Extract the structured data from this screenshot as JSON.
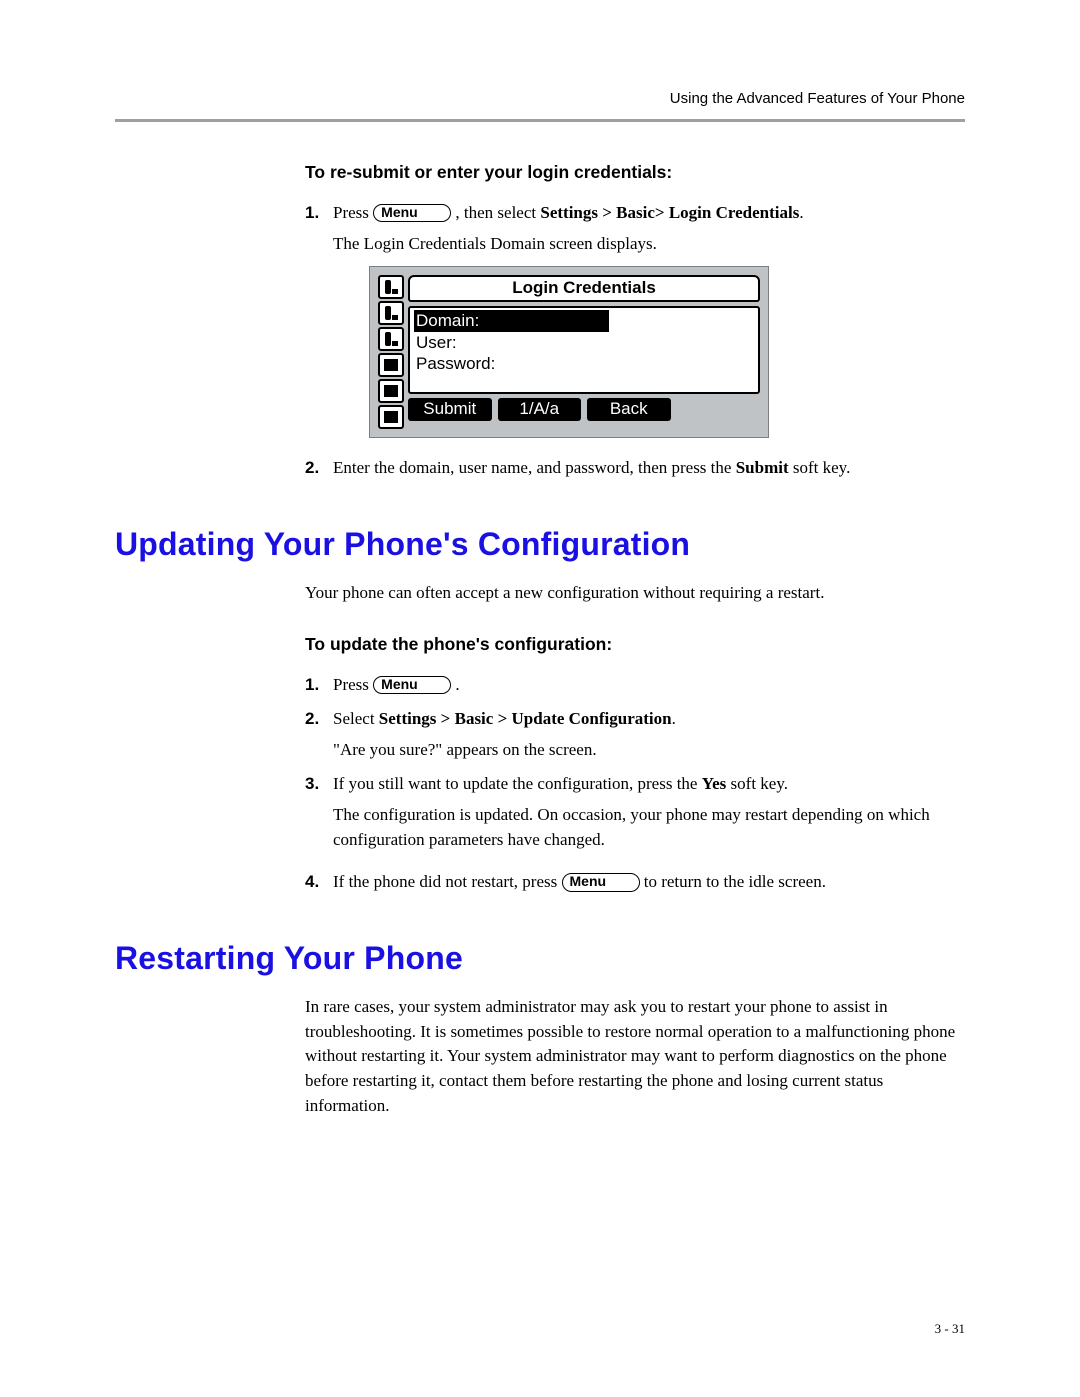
{
  "header": {
    "running_title": "Using the Advanced Features of Your Phone"
  },
  "section_login": {
    "subheading": "To re-submit or enter your login credentials:",
    "step1_num": "1.",
    "step1_a": "Press ",
    "menu_label": "Menu",
    "step1_b": " , then select ",
    "step1_bold": "Settings > Basic> Login Credentials",
    "step1_c": ".",
    "step1_note": "The Login Credentials Domain screen displays.",
    "step2_num": "2.",
    "step2_a": "Enter the domain, user name, and password, then press the ",
    "step2_bold": "Submit",
    "step2_b": " soft key."
  },
  "lcd": {
    "title": "Login Credentials",
    "field1": "Domain:",
    "field2": "User:",
    "field3": "Password:",
    "sk1": "Submit",
    "sk2": "1/A/a",
    "sk3": "Back"
  },
  "section_update": {
    "title": "Updating Your Phone's Configuration",
    "intro": "Your phone can often accept a new configuration without requiring a restart.",
    "subheading": "To update the phone's configuration:",
    "s1_num": "1.",
    "s1_a": "Press ",
    "s1_b": " .",
    "s2_num": "2.",
    "s2_a": "Select ",
    "s2_bold": "Settings > Basic > Update Configuration",
    "s2_b": ".",
    "s2_note": "\"Are you sure?\" appears on the screen.",
    "s3_num": "3.",
    "s3_a": "If you still want to update the configuration, press the ",
    "s3_bold": "Yes",
    "s3_b": " soft key.",
    "s3_note": "The configuration is updated. On occasion, your phone may restart depending on which configuration parameters have changed.",
    "s4_num": "4.",
    "s4_a": "If the phone did not restart, press ",
    "s4_b": " to return to the idle screen."
  },
  "section_restart": {
    "title": "Restarting Your Phone",
    "intro": "In rare cases, your system administrator may ask you to restart your phone to assist in troubleshooting. It is sometimes possible to restore normal operation to a malfunctioning phone without restarting it. Your system administrator may want to perform diagnostics on the phone before restarting it, contact them before restarting the phone and losing current status information."
  },
  "footer": {
    "page_num": "3 - 31"
  }
}
